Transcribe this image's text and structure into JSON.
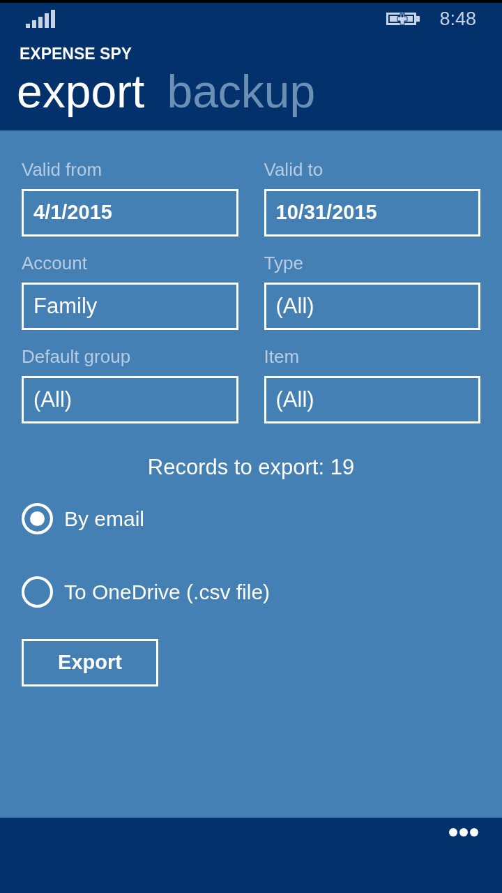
{
  "status_bar": {
    "time": "8:48"
  },
  "app_title": "EXPENSE SPY",
  "pivots": [
    {
      "label": "export",
      "selected": true
    },
    {
      "label": "backup",
      "selected": false
    }
  ],
  "fields": [
    {
      "label": "Valid from",
      "value": "4/1/2015",
      "kind": "date"
    },
    {
      "label": "Valid to",
      "value": "10/31/2015",
      "kind": "date"
    },
    {
      "label": "Account",
      "value": "Family",
      "kind": "picker"
    },
    {
      "label": "Type",
      "value": "(All)",
      "kind": "picker"
    },
    {
      "label": "Default group",
      "value": "(All)",
      "kind": "picker"
    },
    {
      "label": "Item",
      "value": "(All)",
      "kind": "picker"
    }
  ],
  "records": "Records to export: 19",
  "options": [
    {
      "label": "By email",
      "selected": true
    },
    {
      "label": "To OneDrive (.csv file)",
      "selected": false
    }
  ],
  "export_button": "Export"
}
